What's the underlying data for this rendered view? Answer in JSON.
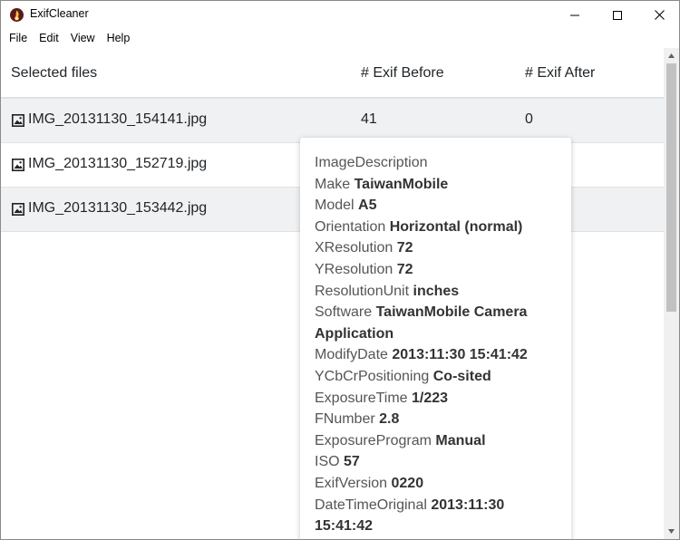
{
  "window": {
    "title": "ExifCleaner"
  },
  "menu": {
    "items": [
      "File",
      "Edit",
      "View",
      "Help"
    ]
  },
  "table": {
    "headers": {
      "files": "Selected files",
      "before": "# Exif Before",
      "after": "# Exif After"
    },
    "rows": [
      {
        "name": "IMG_20131130_154141.jpg",
        "before": "41",
        "after": "0"
      },
      {
        "name": "IMG_20131130_152719.jpg",
        "before": "",
        "after": ""
      },
      {
        "name": "IMG_20131130_153442.jpg",
        "before": "",
        "after": ""
      }
    ]
  },
  "tooltip": {
    "entries": [
      {
        "key": "ImageDescription",
        "value": ""
      },
      {
        "key": "Make",
        "value": "TaiwanMobile"
      },
      {
        "key": "Model",
        "value": "A5"
      },
      {
        "key": "Orientation",
        "value": "Horizontal (normal)"
      },
      {
        "key": "XResolution",
        "value": "72"
      },
      {
        "key": "YResolution",
        "value": "72"
      },
      {
        "key": "ResolutionUnit",
        "value": "inches"
      },
      {
        "key": "Software",
        "value": "TaiwanMobile Camera Application"
      },
      {
        "key": "ModifyDate",
        "value": "2013:11:30 15:41:42"
      },
      {
        "key": "YCbCrPositioning",
        "value": "Co-sited"
      },
      {
        "key": "ExposureTime",
        "value": "1/223"
      },
      {
        "key": "FNumber",
        "value": "2.8"
      },
      {
        "key": "ExposureProgram",
        "value": "Manual"
      },
      {
        "key": "ISO",
        "value": "57"
      },
      {
        "key": "ExifVersion",
        "value": "0220"
      },
      {
        "key": "DateTimeOriginal",
        "value": "2013:11:30 15:41:42"
      }
    ]
  },
  "icons": {
    "app": "exifcleaner-logo-icon",
    "file": "image-file-icon",
    "minimize": "minimize-icon",
    "maximize": "maximize-icon",
    "close": "close-icon"
  },
  "colors": {
    "row_stripe": "#f0f1f3",
    "border": "#dee2e6",
    "app_icon": "#5b1a1a"
  }
}
